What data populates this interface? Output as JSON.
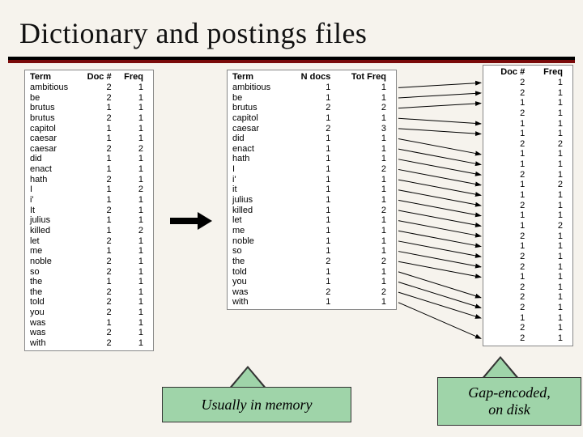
{
  "title": "Dictionary and postings files",
  "left_table": {
    "headers": [
      "Term",
      "Doc #",
      "Freq"
    ],
    "rows": [
      [
        "ambitious",
        2,
        1
      ],
      [
        "be",
        2,
        1
      ],
      [
        "brutus",
        1,
        1
      ],
      [
        "brutus",
        2,
        1
      ],
      [
        "capitol",
        1,
        1
      ],
      [
        "caesar",
        1,
        1
      ],
      [
        "caesar",
        2,
        2
      ],
      [
        "did",
        1,
        1
      ],
      [
        "enact",
        1,
        1
      ],
      [
        "hath",
        2,
        1
      ],
      [
        "I",
        1,
        2
      ],
      [
        "i'",
        1,
        1
      ],
      [
        "It",
        2,
        1
      ],
      [
        "julius",
        1,
        1
      ],
      [
        "killed",
        1,
        2
      ],
      [
        "let",
        2,
        1
      ],
      [
        "me",
        1,
        1
      ],
      [
        "noble",
        2,
        1
      ],
      [
        "so",
        2,
        1
      ],
      [
        "the",
        1,
        1
      ],
      [
        "the",
        2,
        1
      ],
      [
        "told",
        2,
        1
      ],
      [
        "you",
        2,
        1
      ],
      [
        "was",
        1,
        1
      ],
      [
        "was",
        2,
        1
      ],
      [
        "with",
        2,
        1
      ]
    ]
  },
  "mid_table": {
    "headers": [
      "Term",
      "N docs",
      "Tot Freq"
    ],
    "rows": [
      [
        "ambitious",
        1,
        1
      ],
      [
        "be",
        1,
        1
      ],
      [
        "brutus",
        2,
        2
      ],
      [
        "capitol",
        1,
        1
      ],
      [
        "caesar",
        2,
        3
      ],
      [
        "did",
        1,
        1
      ],
      [
        "enact",
        1,
        1
      ],
      [
        "hath",
        1,
        1
      ],
      [
        "I",
        1,
        2
      ],
      [
        "i'",
        1,
        1
      ],
      [
        "it",
        1,
        1
      ],
      [
        "julius",
        1,
        1
      ],
      [
        "killed",
        1,
        2
      ],
      [
        "let",
        1,
        1
      ],
      [
        "me",
        1,
        1
      ],
      [
        "noble",
        1,
        1
      ],
      [
        "so",
        1,
        1
      ],
      [
        "the",
        2,
        2
      ],
      [
        "told",
        1,
        1
      ],
      [
        "you",
        1,
        1
      ],
      [
        "was",
        2,
        2
      ],
      [
        "with",
        1,
        1
      ]
    ]
  },
  "right_table": {
    "headers": [
      "Doc #",
      "Freq"
    ],
    "rows": [
      [
        2,
        1
      ],
      [
        2,
        1
      ],
      [
        1,
        1
      ],
      [
        2,
        1
      ],
      [
        1,
        1
      ],
      [
        1,
        1
      ],
      [
        2,
        2
      ],
      [
        1,
        1
      ],
      [
        1,
        1
      ],
      [
        2,
        1
      ],
      [
        1,
        2
      ],
      [
        1,
        1
      ],
      [
        2,
        1
      ],
      [
        1,
        1
      ],
      [
        1,
        2
      ],
      [
        2,
        1
      ],
      [
        1,
        1
      ],
      [
        2,
        1
      ],
      [
        2,
        1
      ],
      [
        1,
        1
      ],
      [
        2,
        1
      ],
      [
        2,
        1
      ],
      [
        2,
        1
      ],
      [
        1,
        1
      ],
      [
        2,
        1
      ],
      [
        2,
        1
      ]
    ]
  },
  "callouts": {
    "memory": "Usually in memory",
    "disk": "Gap-encoded,\non disk"
  },
  "pointer_map": [
    [
      0,
      0
    ],
    [
      1,
      1
    ],
    [
      2,
      2
    ],
    [
      3,
      4
    ],
    [
      4,
      5
    ],
    [
      5,
      7
    ],
    [
      6,
      8
    ],
    [
      7,
      9
    ],
    [
      8,
      10
    ],
    [
      9,
      11
    ],
    [
      10,
      12
    ],
    [
      11,
      13
    ],
    [
      12,
      14
    ],
    [
      13,
      15
    ],
    [
      14,
      16
    ],
    [
      15,
      17
    ],
    [
      16,
      18
    ],
    [
      17,
      19
    ],
    [
      18,
      21
    ],
    [
      19,
      22
    ],
    [
      20,
      23
    ],
    [
      21,
      25
    ]
  ]
}
